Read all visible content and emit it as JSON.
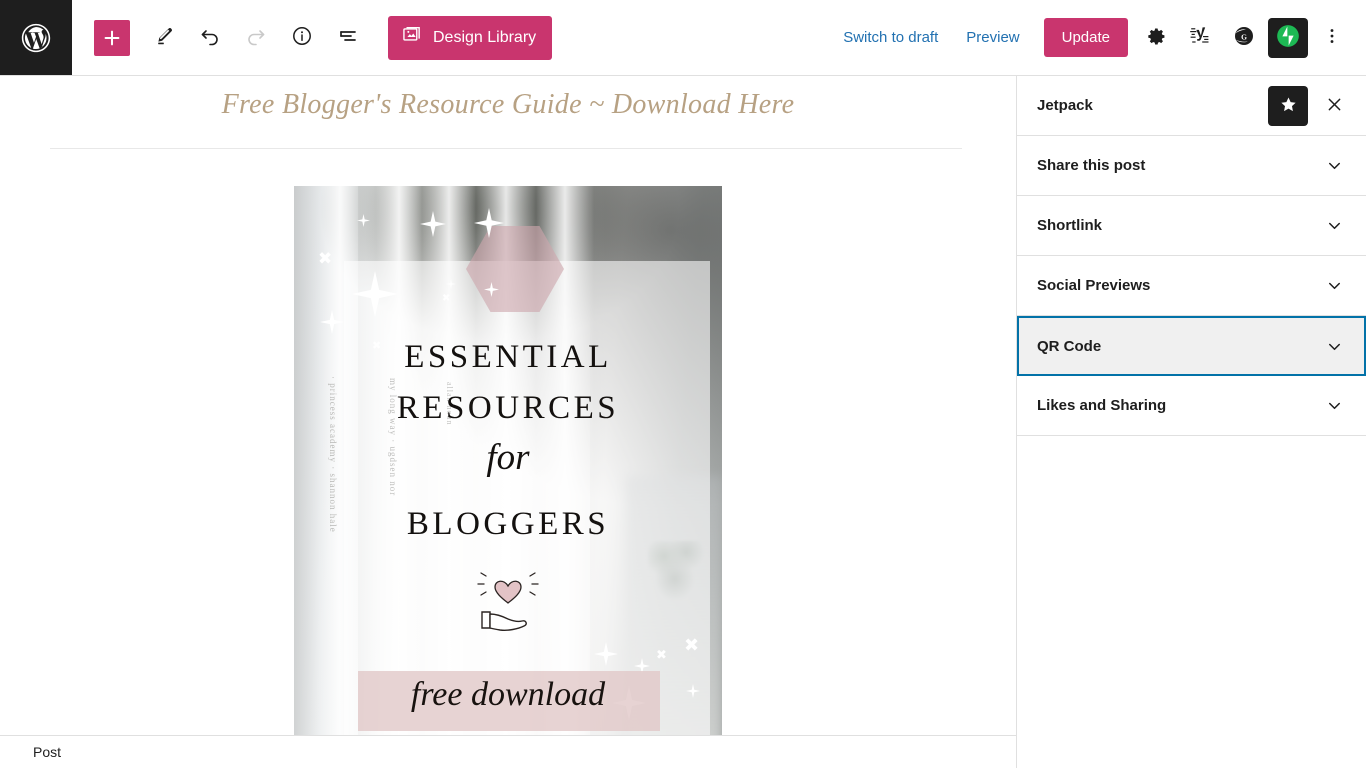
{
  "toolbar": {
    "wp_logo_name": "wordpress-logo",
    "add_block_label": "+",
    "tools": [
      {
        "name": "tools-edit-icon",
        "label": "Tools"
      },
      {
        "name": "undo-icon",
        "label": "Undo"
      },
      {
        "name": "redo-icon",
        "label": "Redo"
      },
      {
        "name": "details-info-icon",
        "label": "Details"
      },
      {
        "name": "list-view-icon",
        "label": "List View"
      }
    ],
    "design_library_label": "Design Library",
    "switch_to_draft_label": "Switch to draft",
    "preview_label": "Preview",
    "update_label": "Update",
    "settings_label": "Settings",
    "yoast_label": "Yoast SEO",
    "grammarly_label": "Grammarly",
    "jetpack_label": "Jetpack",
    "options_label": "Options",
    "accent_pink": "#c9356e",
    "link_blue": "#2271b1",
    "dark": "#1e1e1e"
  },
  "editor": {
    "post_title": "Free Blogger's Resource Guide ~ Download Here",
    "title_color": "#b7a183",
    "featured_image": {
      "name": "essential-resources-for-bloggers-graphic",
      "line1": "ESSENTIAL",
      "line2": "RESOURCES",
      "line3": "for",
      "line4": "BLOGGERS",
      "line5": "free download",
      "band_color": "#e1c8c8",
      "hexagon_color": "#cda6ac"
    }
  },
  "sidebar": {
    "title": "Jetpack",
    "pin_icon": "star-icon",
    "close_icon": "close-icon",
    "panels": [
      {
        "label": "Share this post",
        "focused": false
      },
      {
        "label": "Shortlink",
        "focused": false
      },
      {
        "label": "Social Previews",
        "focused": false
      },
      {
        "label": "QR Code",
        "focused": true
      },
      {
        "label": "Likes and Sharing",
        "focused": false
      }
    ],
    "focus_outline_color": "#0272a8",
    "focus_bg_color": "#f0f0f0"
  },
  "bottom_bar": {
    "breadcrumb": "Post"
  }
}
